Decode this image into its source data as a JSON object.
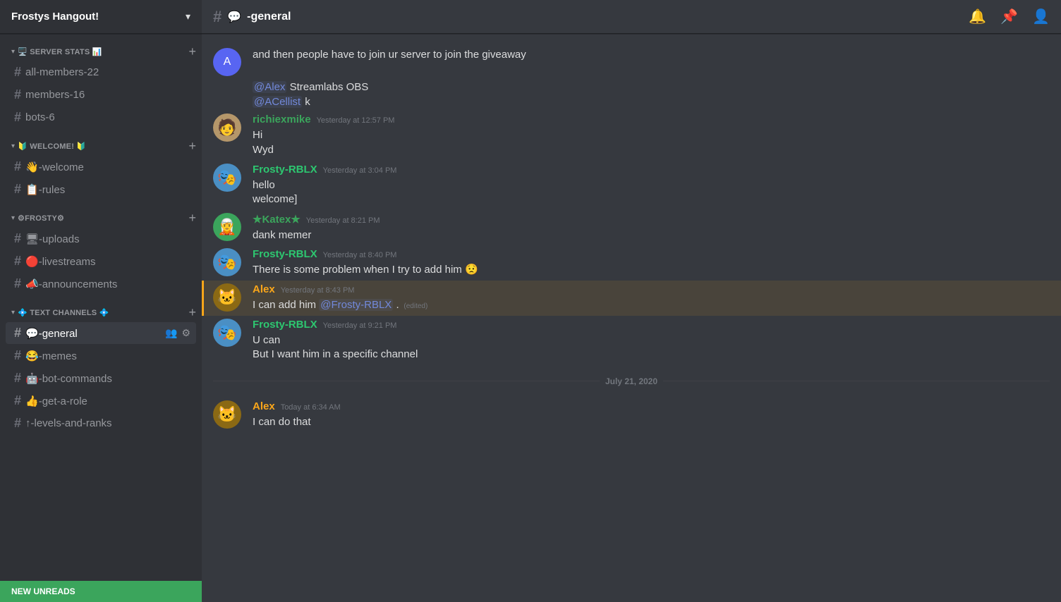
{
  "server": {
    "name": "Frostys Hangout!",
    "chevron": "▾"
  },
  "sidebar": {
    "categories": [
      {
        "id": "server-stats",
        "name": "🖥️ SERVER STATS 📊",
        "addable": true,
        "channels": [
          {
            "id": "all-members",
            "name": "all-members-22",
            "icon": ""
          },
          {
            "id": "members",
            "name": "members-16",
            "icon": ""
          },
          {
            "id": "bots",
            "name": "bots-6",
            "icon": ""
          }
        ]
      },
      {
        "id": "welcome",
        "name": "🔰 WELCOME! 🔰",
        "addable": true,
        "channels": [
          {
            "id": "welcome-ch",
            "name": "👋-welcome",
            "icon": ""
          },
          {
            "id": "rules",
            "name": "📋-rules",
            "icon": ""
          }
        ]
      },
      {
        "id": "frosty",
        "name": "⚙FROSTY⚙",
        "addable": true,
        "channels": [
          {
            "id": "uploads",
            "name": "🖥-uploads",
            "icon": ""
          },
          {
            "id": "livestreams",
            "name": "🔴-livestreams",
            "icon": ""
          },
          {
            "id": "announcements",
            "name": "📣-announcements",
            "icon": ""
          }
        ]
      },
      {
        "id": "text-channels",
        "name": "💠 TEXT CHANNELS 💠",
        "addable": true,
        "channels": [
          {
            "id": "general",
            "name": "💬-general",
            "icon": "",
            "active": true
          },
          {
            "id": "memes",
            "name": "😂-memes",
            "icon": ""
          },
          {
            "id": "bot-commands",
            "name": "🤖-bot-commands",
            "icon": ""
          },
          {
            "id": "get-a-role",
            "name": "👍-get-a-role",
            "icon": ""
          },
          {
            "id": "levels-and-ranks",
            "name": "↑-levels-and-ranks",
            "icon": ""
          }
        ]
      }
    ]
  },
  "channel_header": {
    "hash": "#",
    "icon": "💬",
    "name": "-general"
  },
  "header_icons": {
    "bell": "🔔",
    "pin": "📌",
    "user": "👤"
  },
  "messages": [
    {
      "id": "msg1",
      "type": "continuation",
      "avatar_color": "#5865f2",
      "avatar_text": "A",
      "text": "and then people have to join ur server to join the giveaway",
      "reply": null
    },
    {
      "id": "msg2",
      "type": "continuation-no-avatar",
      "text": "@Alex Streamlabs OBS\n@ACellist k",
      "mentions": [
        "@Alex",
        "@ACellist"
      ]
    },
    {
      "id": "msg3",
      "type": "full",
      "author": "richiexmike",
      "author_color": "green",
      "timestamp": "Yesterday at 12:57 PM",
      "avatar_color": "#b5976a",
      "avatar_text": "R",
      "avatar_img": true,
      "lines": [
        "Hi",
        "Wyd"
      ]
    },
    {
      "id": "msg4",
      "type": "full",
      "author": "Frosty-RBLX",
      "author_color": "teal",
      "timestamp": "Yesterday at 3:04 PM",
      "avatar_color": "#5865f2",
      "avatar_text": "F",
      "avatar_img": true,
      "lines": [
        "hello",
        "welcome]"
      ]
    },
    {
      "id": "msg5",
      "type": "full",
      "author": "★Katex★",
      "author_color": "green",
      "timestamp": "Yesterday at 8:21 PM",
      "avatar_color": "#3ba55c",
      "avatar_text": "K",
      "avatar_img": true,
      "lines": [
        "dank memer"
      ]
    },
    {
      "id": "msg6",
      "type": "full",
      "author": "Frosty-RBLX",
      "author_color": "teal",
      "timestamp": "Yesterday at 8:40 PM",
      "avatar_color": "#5865f2",
      "avatar_text": "F",
      "avatar_img": true,
      "lines": [
        "There is some problem when I try to add him 😟"
      ]
    },
    {
      "id": "msg7",
      "type": "full",
      "author": "Alex",
      "author_color": "orange",
      "timestamp": "Yesterday at 8:43 PM",
      "avatar_color": "#8b6914",
      "avatar_text": "A",
      "avatar_img": true,
      "highlighted": true,
      "lines": [
        "I can add him @Frosty-RBLX . (edited)"
      ],
      "has_mention": true,
      "has_edited": true
    },
    {
      "id": "msg8",
      "type": "full",
      "author": "Frosty-RBLX",
      "author_color": "teal",
      "timestamp": "Yesterday at 9:21 PM",
      "avatar_color": "#5865f2",
      "avatar_text": "F",
      "avatar_img": true,
      "lines": [
        "U can",
        "But I want him in a specific channel"
      ]
    },
    {
      "id": "divider1",
      "type": "date-divider",
      "text": "July 21, 2020"
    },
    {
      "id": "msg9",
      "type": "full",
      "author": "Alex",
      "author_color": "orange",
      "timestamp": "Today at 6:34 AM",
      "avatar_color": "#8b6914",
      "avatar_text": "A",
      "avatar_img": true,
      "lines": [
        "I can do that"
      ]
    }
  ],
  "unread_bar": {
    "label": "NEW UNREADS"
  },
  "avatars": {
    "richiexmike": "🧑",
    "frosty": "🎭",
    "katex": "🧝",
    "alex": "🐱"
  }
}
